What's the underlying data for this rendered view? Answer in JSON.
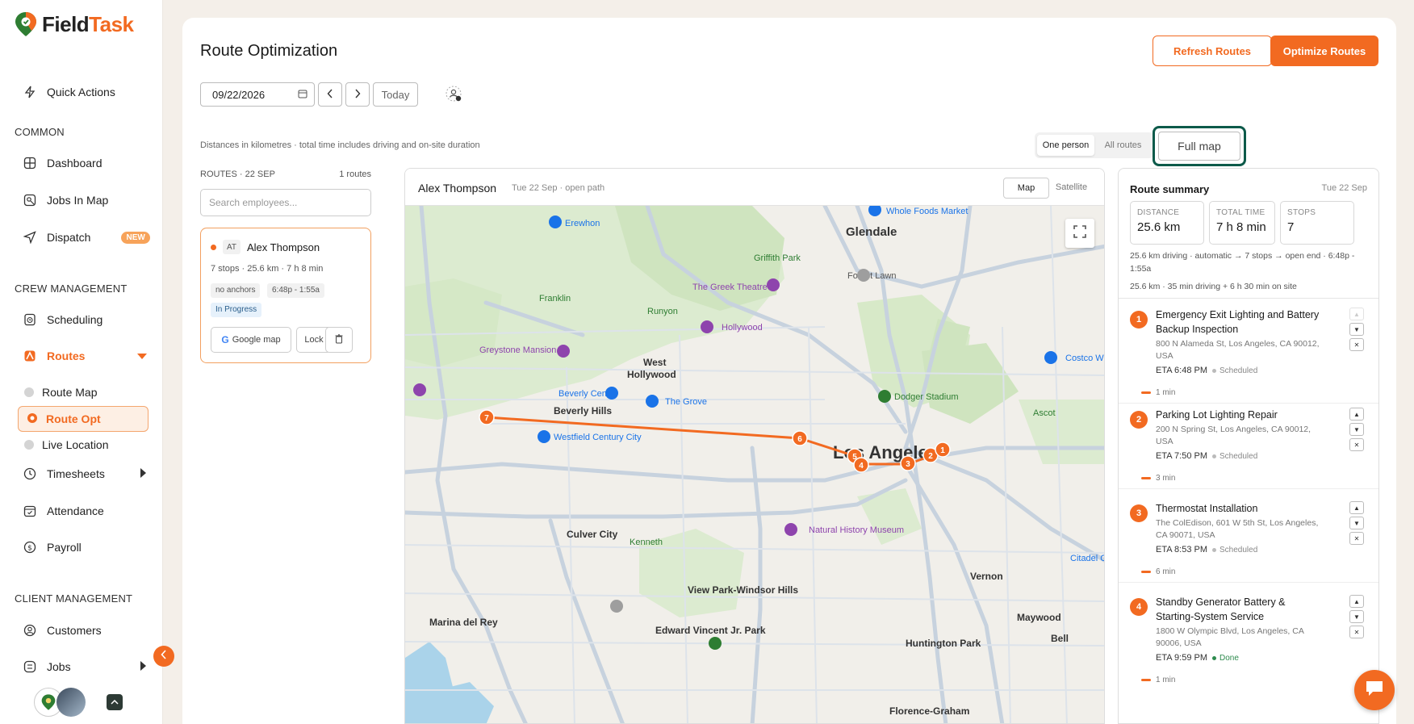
{
  "app": {
    "logo_part1": "Field",
    "logo_part2": "Task"
  },
  "sidebar": {
    "quick_actions": "Quick Actions",
    "common_label": "COMMON",
    "dashboard": "Dashboard",
    "jobs_in_map": "Jobs In Map",
    "dispatch": "Dispatch",
    "dispatch_badge": "NEW",
    "crew_label": "CREW MANAGEMENT",
    "scheduling": "Scheduling",
    "routes": "Routes",
    "route_map": "Route Map",
    "route_opt": "Route Opt",
    "live_location": "Live Location",
    "timesheets": "Timesheets",
    "attendance": "Attendance",
    "payroll": "Payroll",
    "client_label": "CLIENT MANAGEMENT",
    "customers": "Customers",
    "jobs": "Jobs"
  },
  "header": {
    "title": "Route Optimization",
    "refresh": "Refresh Routes",
    "optimize": "Optimize Routes",
    "date": "09/22/2026",
    "today": "Today",
    "hint": "Distances in kilometres · total time includes driving and on-site duration",
    "seg_one": "One person",
    "seg_all": "All routes",
    "full_map": "Full map"
  },
  "routes_list": {
    "heading": "ROUTES · 22 SEP",
    "count": "1 routes",
    "search_placeholder": "Search employees...",
    "card": {
      "initials": "AT",
      "name": "Alex Thompson",
      "meta": "7 stops · 25.6 km · 7 h 8 min",
      "chip1": "no anchors",
      "chip2": "6:48p - 1:55a",
      "status": "In Progress",
      "google": "Google map",
      "lock": "Lock"
    }
  },
  "map": {
    "name": "Alex Thompson",
    "sub": "Tue 22 Sep · open path",
    "tab_map": "Map",
    "tab_sat": "Satellite",
    "labels": {
      "glendale": "Glendale",
      "los_angeles": "Los Angeles",
      "west_hollywood": "West\nHollywood",
      "beverly_hills": "Beverly Hills",
      "culver_city": "Culver City",
      "vernon": "Vernon",
      "erewhon": "Erewhon",
      "whole_foods": "Whole Foods Market",
      "griffith": "Griffith Park",
      "greek": "The Greek Theatre",
      "forest_lawn": "Forest Lawn",
      "franklin": "Franklin Canyon Park, Mountains Recreation...",
      "runyon": "Runyon Canyon Park",
      "walk_of_fame": "Hollywood Walk of Fame",
      "greystone": "Greystone Mansion & Gardens: The...",
      "beverly_center": "Beverly Center",
      "the_grove": "The Grove",
      "dodger": "Dodger Stadium",
      "westfield": "Westfield Century City",
      "ascot": "Ascot Hills Park",
      "costco": "Costco Wh",
      "nhm": "Natural History Museum of Los Angeles County",
      "kenneth": "Kenneth Hahn State Recreation Area",
      "view_park": "View Park-Windsor Hills",
      "marina": "Marina del Rey",
      "edward": "Edward Vincent Jr. Park",
      "huntington": "Huntington Park",
      "maywood": "Maywood",
      "bell": "Bell",
      "florence": "Florence-Graham",
      "citadel": "Citadel Ou"
    },
    "stops": [
      "1",
      "2",
      "3",
      "4",
      "5",
      "6",
      "7"
    ]
  },
  "summary": {
    "title": "Route summary",
    "date": "Tue 22 Sep",
    "distance_label": "DISTANCE",
    "distance": "25.6 km",
    "time_label": "TOTAL TIME",
    "time": "7 h 8 min",
    "stops_label": "STOPS",
    "stops": "7",
    "line1": "25.6 km driving · automatic → 7 stops → open end · 6:48p - 1:55a",
    "line2": "25.6 km · 35 min driving + 6 h 30 min on site",
    "items": [
      {
        "num": "1",
        "title": "Emergency Exit Lighting and Battery Backup Inspection",
        "addr": "800 N Alameda St, Los Angeles, CA 90012, USA",
        "eta": "ETA 6:48 PM",
        "status": "Scheduled",
        "leg": "1 min"
      },
      {
        "num": "2",
        "title": "Parking Lot Lighting Repair",
        "addr": "200 N Spring St, Los Angeles, CA 90012, USA",
        "eta": "ETA 7:50 PM",
        "status": "Scheduled",
        "leg": "3 min"
      },
      {
        "num": "3",
        "title": "Thermostat Installation",
        "addr": "The ColEdison, 601 W 5th St, Los Angeles, CA 90071, USA",
        "eta": "ETA 8:53 PM",
        "status": "Scheduled",
        "leg": "6 min"
      },
      {
        "num": "4",
        "title": "Standby Generator Battery & Starting-System Service",
        "addr": "1800 W Olympic Blvd, Los Angeles, CA 90006, USA",
        "eta": "ETA 9:59 PM",
        "status": "Done",
        "leg": "1 min"
      }
    ]
  },
  "colors": {
    "accent": "#f26a21",
    "map_bg": "#f1efea",
    "park": "#d8ebc9",
    "water": "#aad3ea",
    "road": "#c9d3df",
    "route": "#f26a21"
  }
}
